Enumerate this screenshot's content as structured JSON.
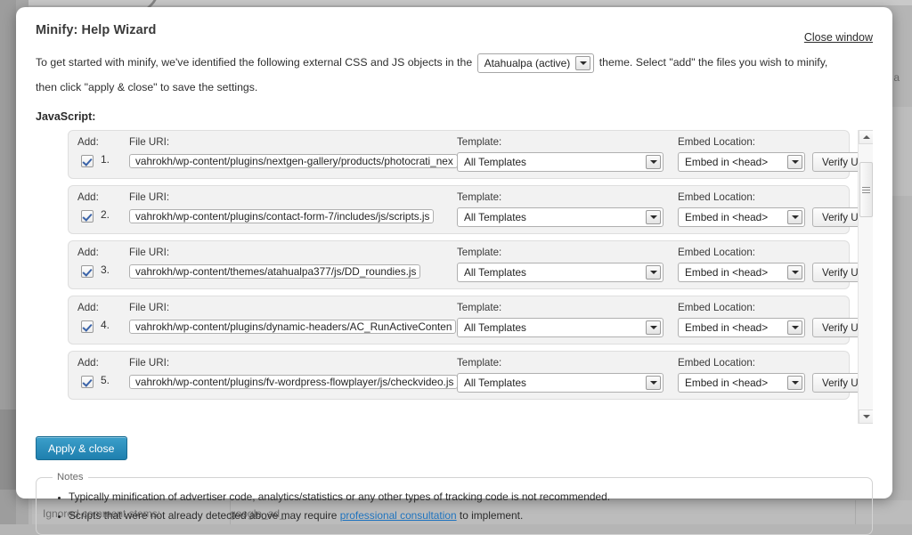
{
  "background": {
    "field_label": "Ignored comment stems:",
    "field_value": "google_ad_",
    "fragment_right": "th a"
  },
  "modal": {
    "title": "Minify: Help Wizard",
    "close_label": "Close window",
    "intro_part1": "To get started with minify, we've identified the following external CSS and JS objects in the",
    "intro_part2": "theme. Select \"add\" the files you wish to minify, then click \"apply & close\" to save the settings.",
    "theme_select": {
      "value": "Atahualpa (active)",
      "icon": "chevron-down-icon"
    },
    "section_label": "JavaScript:",
    "columns": {
      "add": "Add:",
      "file_uri": "File URI:",
      "template": "Template:",
      "embed_location": "Embed Location:"
    },
    "verify_label": "Verify URI",
    "rows": [
      {
        "num": "1.",
        "checked": true,
        "uri": "vahrokh/wp-content/plugins/nextgen-gallery/products/photocrati_nex",
        "template": "All Templates",
        "embed": "Embed in <head>"
      },
      {
        "num": "2.",
        "checked": true,
        "uri": "vahrokh/wp-content/plugins/contact-form-7/includes/js/scripts.js",
        "template": "All Templates",
        "embed": "Embed in <head>"
      },
      {
        "num": "3.",
        "checked": true,
        "uri": "vahrokh/wp-content/themes/atahualpa377/js/DD_roundies.js",
        "template": "All Templates",
        "embed": "Embed in <head>"
      },
      {
        "num": "4.",
        "checked": true,
        "uri": "vahrokh/wp-content/plugins/dynamic-headers/AC_RunActiveConten",
        "template": "All Templates",
        "embed": "Embed in <head>"
      },
      {
        "num": "5.",
        "checked": true,
        "uri": "vahrokh/wp-content/plugins/fv-wordpress-flowplayer/js/checkvideo.js",
        "template": "All Templates",
        "embed": "Embed in <head>"
      }
    ],
    "apply_label": "Apply & close",
    "notes": {
      "legend": "Notes",
      "item1": "Typically minification of advertiser code, analytics/statistics or any other types of tracking code is not recommended.",
      "item2_before": "Scripts that were not already detected above may require ",
      "item2_link": "professional consultation",
      "item2_after": " to implement."
    }
  },
  "colors": {
    "accent": "#2180ae",
    "link": "#1e73be",
    "backdrop": "#b5b5b5"
  }
}
